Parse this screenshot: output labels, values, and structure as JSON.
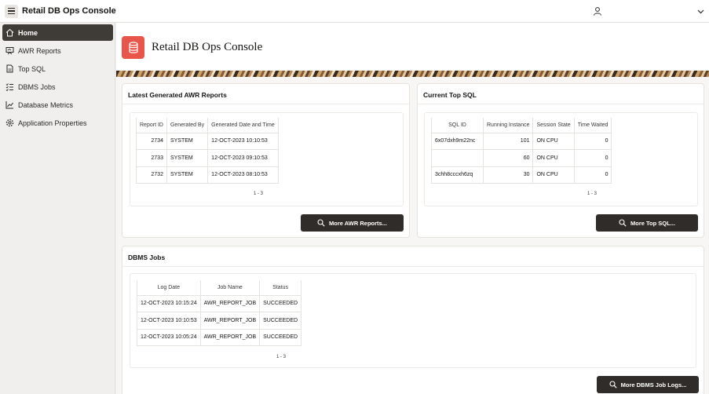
{
  "header": {
    "app_title": "Retail DB Ops Console"
  },
  "icons": {
    "menu": "hamburger-icon",
    "user": "user-icon",
    "dropdown": "chevron-down-icon",
    "hero": "database-icon",
    "search": "search-icon"
  },
  "sidebar": {
    "items": [
      {
        "label": "Home",
        "icon": "home-icon"
      },
      {
        "label": "AWR Reports",
        "icon": "report-icon"
      },
      {
        "label": "Top SQL",
        "icon": "sql-icon"
      },
      {
        "label": "DBMS Jobs",
        "icon": "jobs-icon"
      },
      {
        "label": "Database Metrics",
        "icon": "chart-icon"
      },
      {
        "label": "Application Properties",
        "icon": "gear-icon"
      }
    ]
  },
  "hero": {
    "title": "Retail DB Ops Console"
  },
  "awr": {
    "title": "Latest Generated AWR Reports",
    "columns": [
      "Report ID",
      "Generated By",
      "Generated Date and Time"
    ],
    "rows": [
      [
        "2734",
        "SYSTEM",
        "12-OCT-2023 10:10:53"
      ],
      [
        "2733",
        "SYSTEM",
        "12-OCT-2023 09:10:53"
      ],
      [
        "2732",
        "SYSTEM",
        "12-OCT-2023 08:10:53"
      ]
    ],
    "pager": "1 - 3",
    "button": "More AWR Reports..."
  },
  "topsql": {
    "title": "Current Top SQL",
    "columns": [
      "SQL ID",
      "Running Instance",
      "Session State",
      "Time Waited"
    ],
    "rows": [
      [
        "6x07dxh9m22nc",
        "101",
        "ON CPU",
        "0"
      ],
      [
        "",
        "60",
        "ON CPU",
        "0"
      ],
      [
        "3chh8cccxh6zq",
        "30",
        "ON CPU",
        "0"
      ]
    ],
    "pager": "1 - 3",
    "button": "More Top SQL..."
  },
  "jobs": {
    "title": "DBMS Jobs",
    "columns": [
      "Log Date",
      "Job Name",
      "Status"
    ],
    "rows": [
      [
        "12-OCT-2023 10:15:24",
        "AWR_REPORT_JOB",
        "SUCCEEDED"
      ],
      [
        "12-OCT-2023 10:10:53",
        "AWR_REPORT_JOB",
        "SUCCEEDED"
      ],
      [
        "12-OCT-2023 10:05:24",
        "AWR_REPORT_JOB",
        "SUCCEEDED"
      ]
    ],
    "pager": "1 - 3",
    "button": "More DBMS Job Logs..."
  },
  "colors": {
    "accent": "#e8564b",
    "nav_active": "#3f3b36",
    "button": "#2f2c29"
  }
}
